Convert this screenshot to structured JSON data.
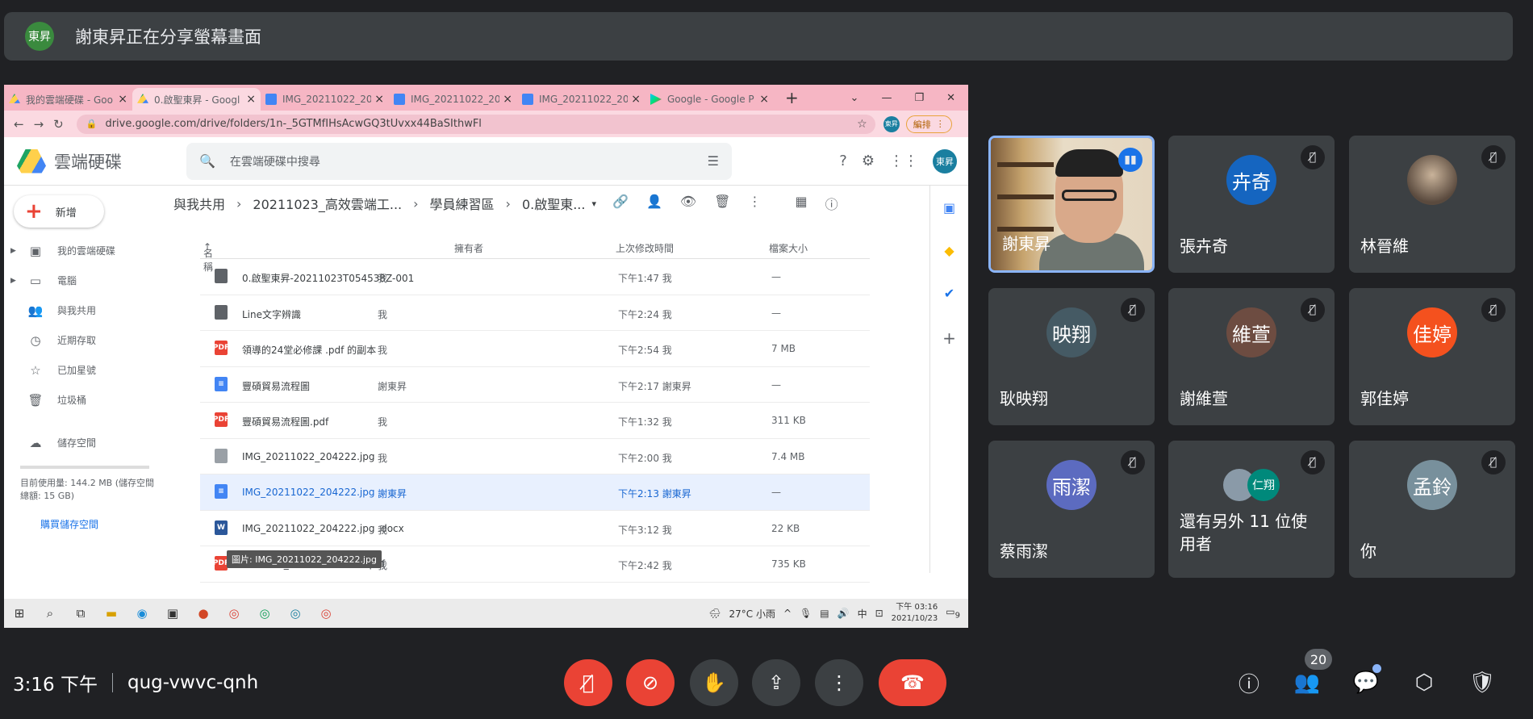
{
  "banner": {
    "presenter_initials": "東昇",
    "text": "謝東昇正在分享螢幕畫面"
  },
  "browser": {
    "tabs": [
      {
        "label": "我的雲端硬碟 - Goo",
        "favicon": "drive-icon",
        "active": false
      },
      {
        "label": "0.啟聖東昇 - Googl",
        "favicon": "drive-icon",
        "active": true
      },
      {
        "label": "IMG_20211022_20",
        "favicon": "docs-icon",
        "active": false
      },
      {
        "label": "IMG_20211022_20",
        "favicon": "docs-icon",
        "active": false
      },
      {
        "label": "IMG_20211022_20",
        "favicon": "docs-icon",
        "active": false
      },
      {
        "label": "Google - Google P",
        "favicon": "play-icon",
        "active": false
      }
    ],
    "new_tab": "+",
    "url": "drive.google.com/drive/folders/1n-_5GTMfIHsAcwGQ3tUvxx44BaSIthwFl",
    "profile_initials": "東昇",
    "edit_label": "編排"
  },
  "drive": {
    "name": "雲端硬碟",
    "search_placeholder": "在雲端硬碟中搜尋",
    "account_initials": "東昇",
    "new_label": "新增",
    "sidebar": [
      {
        "label": "我的雲端硬碟",
        "icon": "drive-folder-icon",
        "expand": true
      },
      {
        "label": "電腦",
        "icon": "computer-icon",
        "expand": true
      },
      {
        "label": "與我共用",
        "icon": "shared-icon",
        "expand": false
      },
      {
        "label": "近期存取",
        "icon": "clock-icon",
        "expand": false
      },
      {
        "label": "已加星號",
        "icon": "star-icon",
        "expand": false
      },
      {
        "label": "垃圾桶",
        "icon": "trash-icon",
        "expand": false
      },
      {
        "label": "儲存空間",
        "icon": "cloud-icon",
        "expand": false
      }
    ],
    "storage_text": "目前使用量: 144.2 MB (儲存空間總額: 15 GB)",
    "buy_storage": "購買儲存空間",
    "breadcrumb": [
      "與我共用",
      "20211023_高效雲端工...",
      "學員練習區",
      "0.啟聖東..."
    ],
    "columns": {
      "name": "名稱",
      "owner": "擁有者",
      "modified": "上次修改時間",
      "size": "檔案大小"
    },
    "files": [
      {
        "name": "0.啟聖東昇-20211023T054538Z-001",
        "type": "folder",
        "owner": "我",
        "modified": "下午1:47 我",
        "size": "—",
        "selected": false
      },
      {
        "name": "Line文字辨識",
        "type": "folder",
        "owner": "我",
        "modified": "下午2:24 我",
        "size": "—",
        "selected": false
      },
      {
        "name": "領導的24堂必修課 .pdf 的副本",
        "type": "pdf",
        "owner": "我",
        "modified": "下午2:54 我",
        "size": "7 MB",
        "selected": false
      },
      {
        "name": "豐碩貿易流程圖",
        "type": "doc",
        "owner": "謝東昇",
        "modified": "下午2:17 謝東昇",
        "size": "—",
        "selected": false
      },
      {
        "name": "豐碩貿易流程圖.pdf",
        "type": "pdf",
        "owner": "我",
        "modified": "下午1:32 我",
        "size": "311 KB",
        "selected": false
      },
      {
        "name": "IMG_20211022_204222.jpg",
        "type": "img",
        "owner": "我",
        "modified": "下午2:00 我",
        "size": "7.4 MB",
        "selected": false
      },
      {
        "name": "IMG_20211022_204222.jpg",
        "type": "doc",
        "owner": "謝東昇",
        "modified": "下午2:13 謝東昇",
        "size": "—",
        "selected": true
      },
      {
        "name": "IMG_20211022_204222.jpg .docx",
        "type": "word",
        "owner": "我",
        "modified": "下午3:12 我",
        "size": "22 KB",
        "selected": false
      },
      {
        "name": "Scanned_20211023-1440.pdf",
        "type": "pdf",
        "owner": "我",
        "modified": "下午2:42 我",
        "size": "735 KB",
        "selected": false
      }
    ],
    "tooltip": "圖片: IMG_20211022_204222.jpg"
  },
  "taskbar": {
    "weather": "27°C 小雨",
    "ime": "中",
    "time": "下午 03:16",
    "date": "2021/10/23",
    "notifications": "9"
  },
  "participants": [
    {
      "name": "謝東昇",
      "initials": "",
      "avatar_color": "",
      "speaking": true,
      "video": true
    },
    {
      "name": "張卉奇",
      "initials": "卉奇",
      "avatar_color": "#1565c0",
      "speaking": false,
      "video": false
    },
    {
      "name": "林晉維",
      "initials": "",
      "avatar_color": "#6b5a4a",
      "speaking": false,
      "video": false
    },
    {
      "name": "耿映翔",
      "initials": "映翔",
      "avatar_color": "#455a64",
      "speaking": false,
      "video": false
    },
    {
      "name": "謝維萱",
      "initials": "維萱",
      "avatar_color": "#6d4c41",
      "speaking": false,
      "video": false
    },
    {
      "name": "郭佳婷",
      "initials": "佳婷",
      "avatar_color": "#f4511e",
      "speaking": false,
      "video": false
    },
    {
      "name": "蔡雨潔",
      "initials": "雨潔",
      "avatar_color": "#5c6bc0",
      "speaking": false,
      "video": false
    },
    {
      "name": "還有另外 11 位使用者",
      "initials": "仁翔",
      "avatar_color": "#00897b",
      "speaking": false,
      "video": false
    },
    {
      "name": "你",
      "initials": "孟鈴",
      "avatar_color": "#78909c",
      "speaking": false,
      "video": false
    }
  ],
  "meeting": {
    "time": "3:16 下午",
    "code": "qug-vwvc-qnh",
    "participant_count": "20"
  }
}
